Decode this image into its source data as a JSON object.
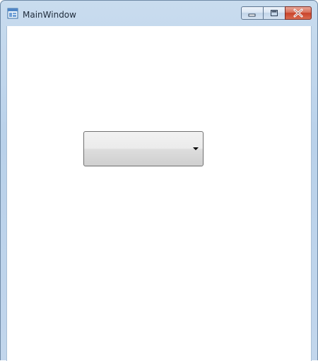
{
  "window": {
    "title": "MainWindow",
    "icon": "app-window-icon",
    "controls": {
      "minimize_icon": "minimize-icon",
      "maximize_icon": "maximize-icon",
      "close_icon": "close-icon"
    }
  },
  "combobox": {
    "selected_value": "",
    "arrow_icon": "chevron-down-icon"
  },
  "colors": {
    "close_button": "#c9432a",
    "frame": "#b9d1ea",
    "client_background": "#ffffff"
  }
}
